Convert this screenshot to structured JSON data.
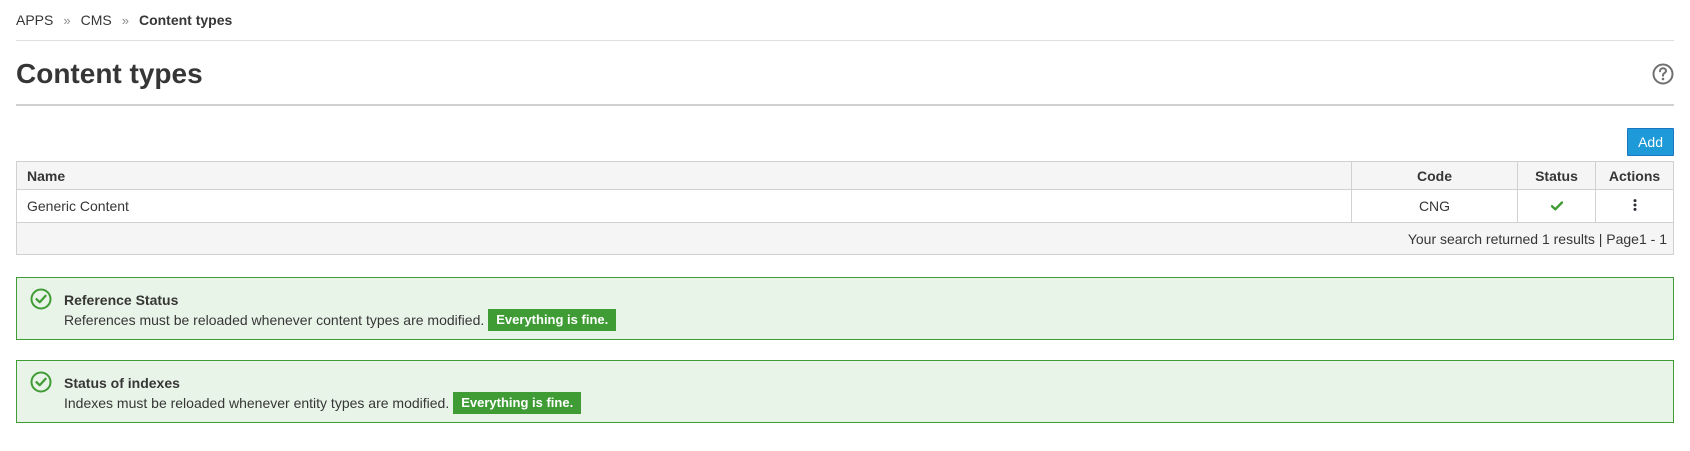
{
  "breadcrumb": {
    "items": [
      "APPS",
      "CMS"
    ],
    "current": "Content types"
  },
  "page": {
    "title": "Content types"
  },
  "toolbar": {
    "add_label": "Add"
  },
  "table": {
    "headers": {
      "name": "Name",
      "code": "Code",
      "status": "Status",
      "actions": "Actions"
    },
    "rows": [
      {
        "name": "Generic Content",
        "code": "CNG",
        "status_icon": "check-icon",
        "actions_icon": "kebab-icon"
      }
    ]
  },
  "pager": {
    "text": "Your search returned 1 results | Page1 - 1"
  },
  "alerts": [
    {
      "title": "Reference Status",
      "message": "References must be reloaded whenever content types are modified.",
      "badge": "Everything is fine."
    },
    {
      "title": "Status of indexes",
      "message": "Indexes must be reloaded whenever entity types are modified.",
      "badge": "Everything is fine."
    }
  ],
  "colors": {
    "success": "#3f9c35",
    "success_bg": "#e9f4e9",
    "primary": "#1f9ad9",
    "text": "#363636"
  }
}
